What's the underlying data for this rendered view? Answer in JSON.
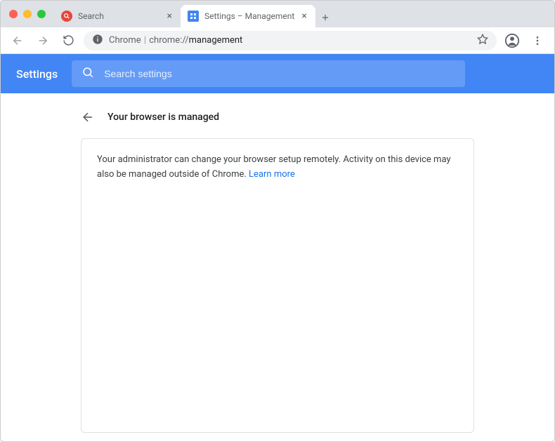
{
  "window": {
    "tabs": [
      {
        "title": "Search",
        "favicon": "search-favicon",
        "active": false
      },
      {
        "title": "Settings – Management",
        "favicon": "settings-favicon",
        "active": true
      }
    ]
  },
  "address": {
    "origin": "Chrome",
    "path_prefix": "chrome://",
    "path_bold": "management"
  },
  "settings": {
    "title": "Settings",
    "search_placeholder": "Search settings"
  },
  "page": {
    "heading": "Your browser is managed",
    "body_text": "Your administrator can change your browser setup remotely. Activity on this device may also be managed outside of Chrome. ",
    "learn_more": "Learn more"
  }
}
